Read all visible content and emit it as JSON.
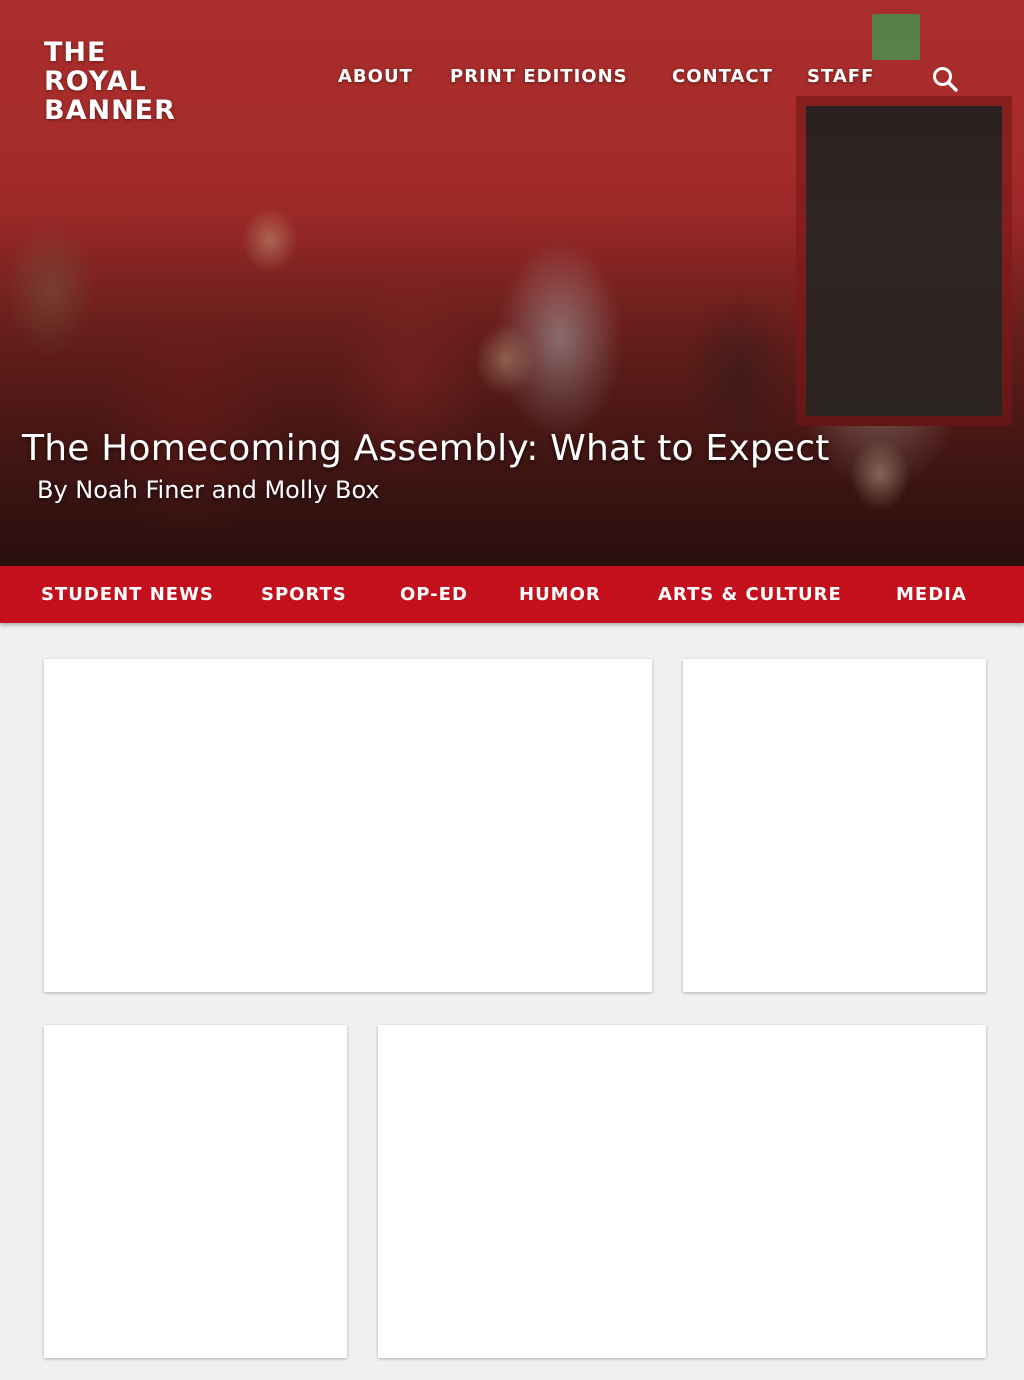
{
  "site": {
    "logo_lines": [
      "THE",
      "ROYAL",
      "BANNER"
    ]
  },
  "top_nav": {
    "items": [
      "ABOUT",
      "PRINT EDITIONS",
      "CONTACT",
      "STAFF"
    ],
    "search_icon": "search-icon"
  },
  "featured": {
    "headline": "The Homecoming Assembly: What to Expect",
    "byline": "By Noah Finer and Molly Box"
  },
  "categories": {
    "items": [
      "STUDENT NEWS",
      "SPORTS",
      "OP-ED",
      "HUMOR",
      "ARTS & CULTURE",
      "MEDIA"
    ]
  },
  "colors": {
    "accent": "#c4101c",
    "page_background": "#f0f0f0",
    "card_background": "#ffffff"
  }
}
